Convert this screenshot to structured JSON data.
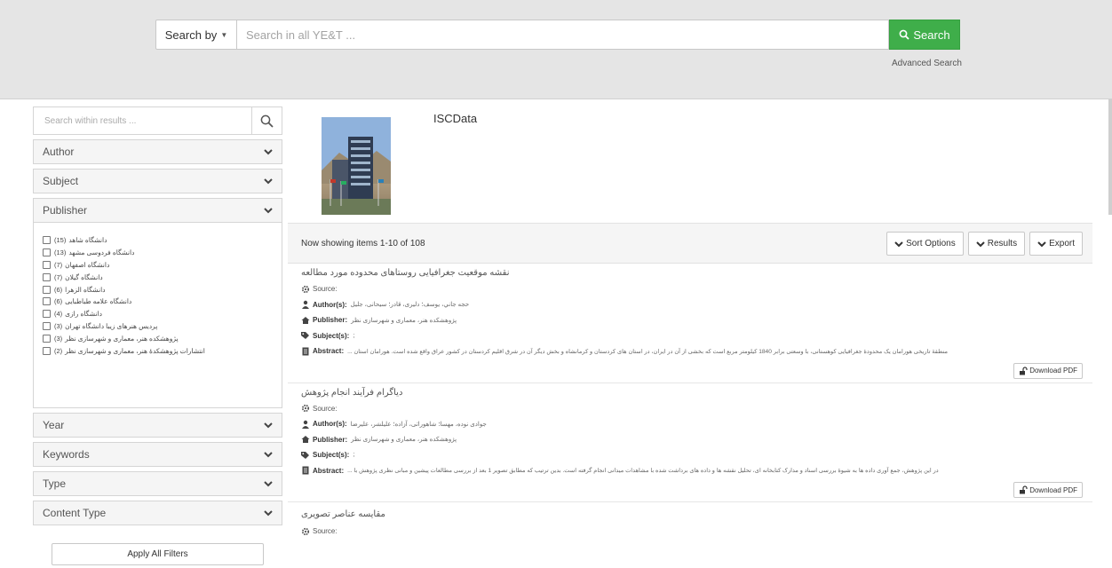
{
  "search": {
    "by_label": "Search by",
    "placeholder": "Search in all YE&T ...",
    "button_label": "Search",
    "advanced_label": "Advanced Search"
  },
  "sidebar": {
    "within_placeholder": "Search within results ...",
    "facets_top": [
      {
        "label": "Author"
      },
      {
        "label": "Subject"
      },
      {
        "label": "Publisher"
      }
    ],
    "publishers": [
      {
        "count": "(15)",
        "name": "دانشگاه شاهد"
      },
      {
        "count": "(13)",
        "name": "دانشگاه فردوسی مشهد"
      },
      {
        "count": "(7)",
        "name": "دانشگاه اصفهان"
      },
      {
        "count": "(7)",
        "name": "دانشگاه گیلان"
      },
      {
        "count": "(6)",
        "name": "دانشگاه الزهرا"
      },
      {
        "count": "(6)",
        "name": "دانشگاه علامه طباطبایی"
      },
      {
        "count": "(4)",
        "name": "دانشگاه رازی"
      },
      {
        "count": "(3)",
        "name": "پردیس هنرهای زیبا دانشگاه تهران"
      },
      {
        "count": "(3)",
        "name": "پژوهشکده هنر، معماری و شهرسازی نظر"
      },
      {
        "count": "(2)",
        "name": "انتشارات پژوهشکدهٔ هنر، معماری و شهرسازی نظر"
      }
    ],
    "facets_bottom": [
      {
        "label": "Year"
      },
      {
        "label": "Keywords"
      },
      {
        "label": "Type"
      },
      {
        "label": "Content Type"
      }
    ],
    "apply_label": "Apply All Filters"
  },
  "collection": {
    "title": "ISCData"
  },
  "results": {
    "showing": "Now showing items 1-10 of 108",
    "sort_label": "Sort Options",
    "results_label": "Results",
    "export_label": "Export",
    "field_labels": {
      "source": "Source:",
      "authors": "Author(s):",
      "publisher": "Publisher:",
      "subjects": "Subject(s):",
      "abstract": "Abstract:"
    },
    "download_label": "Download PDF",
    "items": [
      {
        "title": "نقشه موقعیت جغرافیایی روستاهای محدوده مورد مطالعه",
        "authors": "حجه جاني، يوسف؛ دلیری، قادر؛ سیحانی، جلیل",
        "publisher": "پژوهشکده هنر، معماری و شهرسازی نظر",
        "subjects": ";",
        "abstract": "... منطقهٔ تاریخی هورامان یک محدودهٔ جغرافیایی کوهستانی، با وسعتی برابر 1840 کیلومتر مربع است که بخشی از آن در ایران، در استان های کردستان و کرمانشاه و بخش دیگر آن در شرق اقلیم کردستان در کشور عراق واقع شده است. هورامان استان"
      },
      {
        "title": "دیاگرام فرآیند انجام پژوهش",
        "authors": "جوادی نوده، مهسا؛ شاهوراتی، آزاده؛ علیلشر، علیرضا",
        "publisher": "پژوهشکده هنر، معماری و شهرسازی نظر",
        "subjects": ";",
        "abstract": "... در این پژوهش، جمع آوری داده ها به شیوهٔ بررسی اسناد و مدارک کتابخانه ای، تحلیل نقشه ها و داده های برداشت شده با مشاهدات میدانی انجام گرفته است. بدین ترتیب که مطابق تصویر 1 بعد از بررسی مطالعات پیشین و مبانی نظری پژوهش با"
      },
      {
        "title": "مقایسه عناصر تصویری"
      }
    ]
  }
}
